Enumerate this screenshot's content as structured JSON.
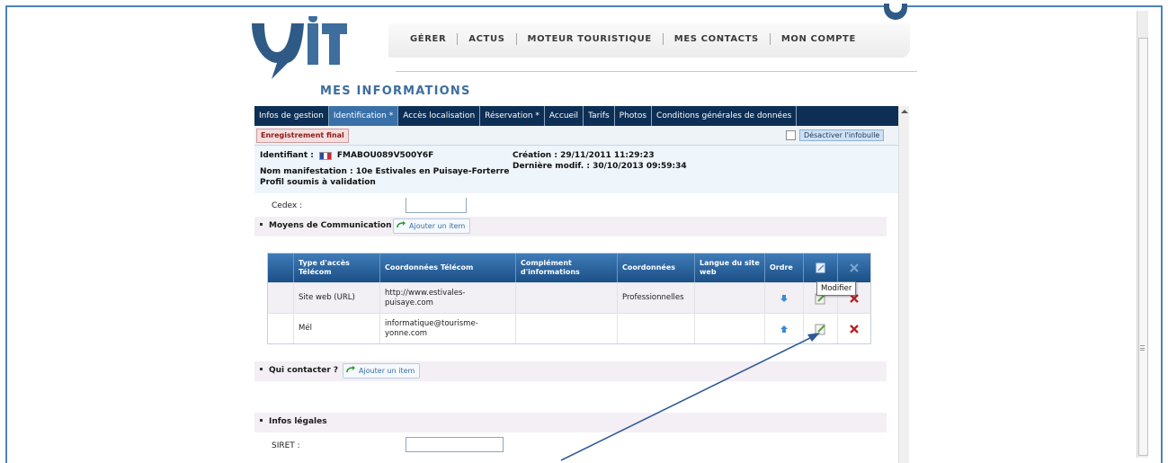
{
  "nav": {
    "items": [
      "GÉRER",
      "ACTUS",
      "MOTEUR TOURISTIQUE",
      "MES CONTACTS",
      "MON COMPTE"
    ]
  },
  "page": {
    "title": "MES INFORMATIONS"
  },
  "tabs": [
    "Infos de gestion",
    "Identification *",
    "Accès localisation",
    "Réservation *",
    "Accueil",
    "Tarifs",
    "Photos",
    "Conditions générales de données"
  ],
  "subbar": {
    "final_label": "Enregistrement final",
    "infobulle_label": "Désactiver l'infobulle"
  },
  "info": {
    "identifiant_label": "Identifiant :",
    "identifiant_value": "FMABOU089V500Y6F",
    "manifestation": "Nom manifestation : 10e Estivales en Puisaye-Forterre",
    "profil": "Profil soumis à validation",
    "creation": "Création : 29/11/2011 11:29:23",
    "modif": "Dernière modif. : 30/10/2013 09:59:34"
  },
  "form": {
    "cedex_label": "Cedex :",
    "cedex_value": "",
    "siret_label": "SIRET :",
    "siret_value": ""
  },
  "sections": {
    "communication": "Moyens de Communication",
    "contacter": "Qui contacter ?",
    "legal": "Infos légales",
    "add_label": "Ajouter un item"
  },
  "table": {
    "headers": [
      "Type d'accès Télécom",
      "Coordonnées Télécom",
      "Complément d'informations",
      "Coordonnées",
      "Langue du site web",
      "Ordre"
    ],
    "rows": [
      {
        "type": "Site web (URL)",
        "coord": "http://www.estivales-puisaye.com",
        "complement": "",
        "coordonnees": "Professionnelles",
        "langue": ""
      },
      {
        "type": "Mél",
        "coord": "informatique@tourisme-yonne.com",
        "complement": "",
        "coordonnees": "",
        "langue": ""
      }
    ]
  },
  "tooltip": "Modifier",
  "colors": {
    "nav_dark": "#0d2f55",
    "tab_active": "#3970a8",
    "title_blue": "#3d6e9e",
    "frame_border": "#4f81bd",
    "callout_arrow": "#2f5a96"
  }
}
